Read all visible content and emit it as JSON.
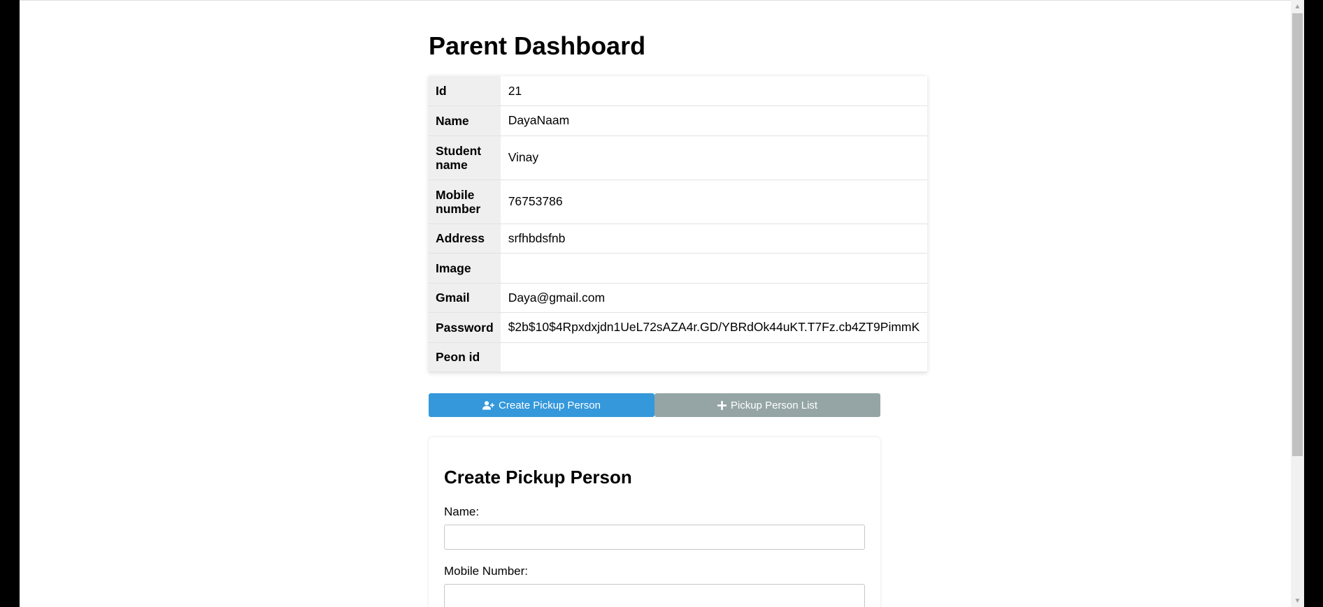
{
  "title": "Parent Dashboard",
  "details": [
    {
      "label": "Id",
      "value": "21"
    },
    {
      "label": "Name",
      "value": "DayaNaam"
    },
    {
      "label": "Student name",
      "value": "Vinay"
    },
    {
      "label": "Mobile number",
      "value": "76753786"
    },
    {
      "label": "Address",
      "value": "srfhbdsfnb"
    },
    {
      "label": "Image",
      "value": ""
    },
    {
      "label": "Gmail",
      "value": "Daya@gmail.com"
    },
    {
      "label": "Password",
      "value": "$2b$10$4Rpxdxjdn1UeL72sAZA4r.GD/YBRdOk44uKT.T7Fz.cb4ZT9PimmK"
    },
    {
      "label": "Peon id",
      "value": ""
    }
  ],
  "buttons": {
    "create_label": "Create Pickup Person",
    "create_icon": "user-plus-icon",
    "create_color": "#3498db",
    "list_label": "Pickup Person List",
    "list_icon": "plus-icon",
    "list_color": "#95a5a6"
  },
  "form": {
    "title": "Create Pickup Person",
    "name_label": "Name:",
    "name_value": "",
    "mobile_label": "Mobile Number:",
    "mobile_value": ""
  }
}
